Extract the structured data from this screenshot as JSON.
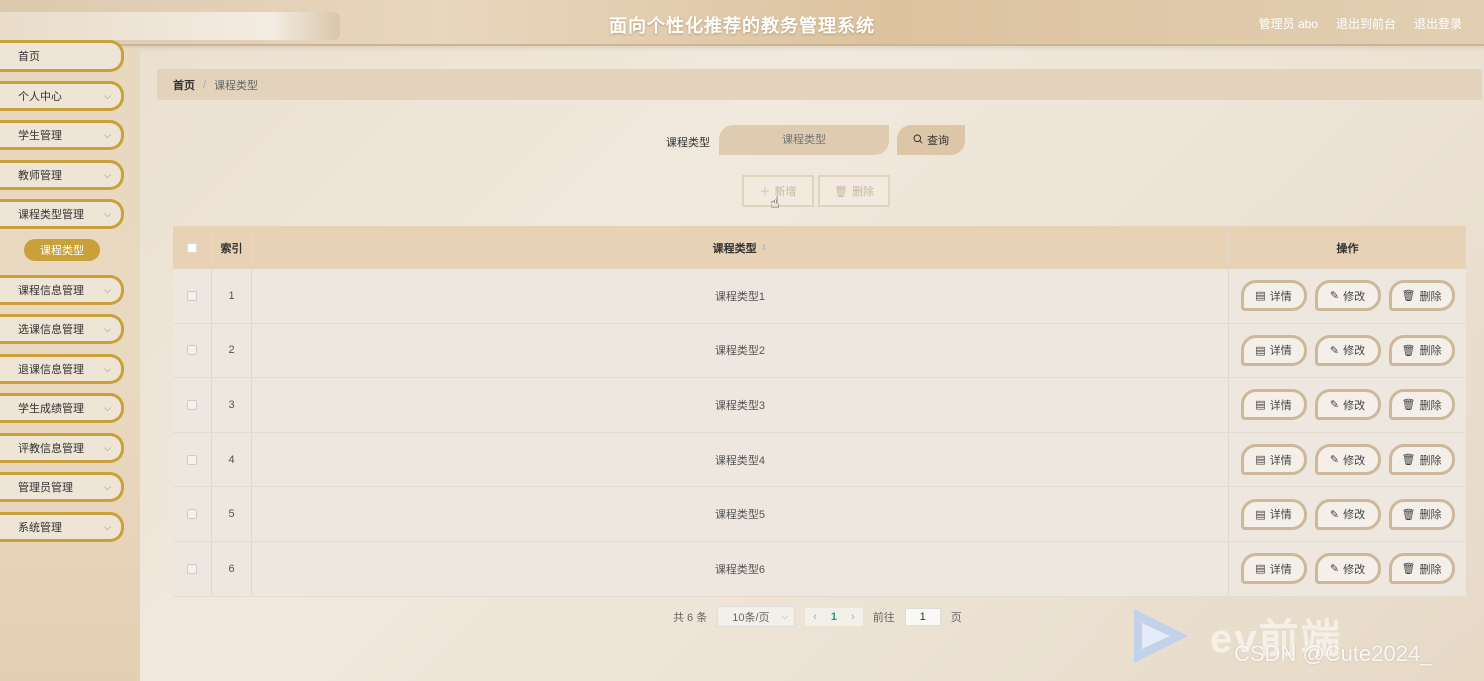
{
  "header": {
    "title": "面向个性化推荐的教务管理系统",
    "user_label": "管理员 abo",
    "to_front": "退出到前台",
    "logout": "退出登录"
  },
  "sidebar": {
    "items": [
      {
        "label": "首页"
      },
      {
        "label": "个人中心"
      },
      {
        "label": "学生管理"
      },
      {
        "label": "教师管理"
      },
      {
        "label": "课程类型管理"
      },
      {
        "label": "课程信息管理"
      },
      {
        "label": "选课信息管理"
      },
      {
        "label": "退课信息管理"
      },
      {
        "label": "学生成绩管理"
      },
      {
        "label": "评教信息管理"
      },
      {
        "label": "管理员管理"
      },
      {
        "label": "系统管理"
      }
    ],
    "active_sub": "课程类型"
  },
  "breadcrumb": {
    "home": "首页",
    "current": "课程类型"
  },
  "search": {
    "label": "课程类型",
    "placeholder": "课程类型",
    "query_label": "查询"
  },
  "actions": {
    "add_label": "新增",
    "delete_label": "删除"
  },
  "table": {
    "headers": {
      "index": "索引",
      "type": "课程类型",
      "ops": "操作"
    },
    "op_labels": {
      "detail": "详情",
      "edit": "修改",
      "delete": "删除"
    },
    "rows": [
      {
        "index": "1",
        "type": "课程类型1"
      },
      {
        "index": "2",
        "type": "课程类型2"
      },
      {
        "index": "3",
        "type": "课程类型3"
      },
      {
        "index": "4",
        "type": "课程类型4"
      },
      {
        "index": "5",
        "type": "课程类型5"
      },
      {
        "index": "6",
        "type": "课程类型6"
      }
    ]
  },
  "pagination": {
    "total": "共 6 条",
    "page_size": "10条/页",
    "current_page": "1",
    "goto_label": "前往",
    "goto_value": "1",
    "page_suffix": "页"
  },
  "watermark": {
    "brand": "ev前端",
    "csdn": "CSDN @Cute2024_"
  },
  "colors": {
    "accent": "#c9a03a",
    "header": "#e7d2b6",
    "link": "#1e9a8a"
  }
}
